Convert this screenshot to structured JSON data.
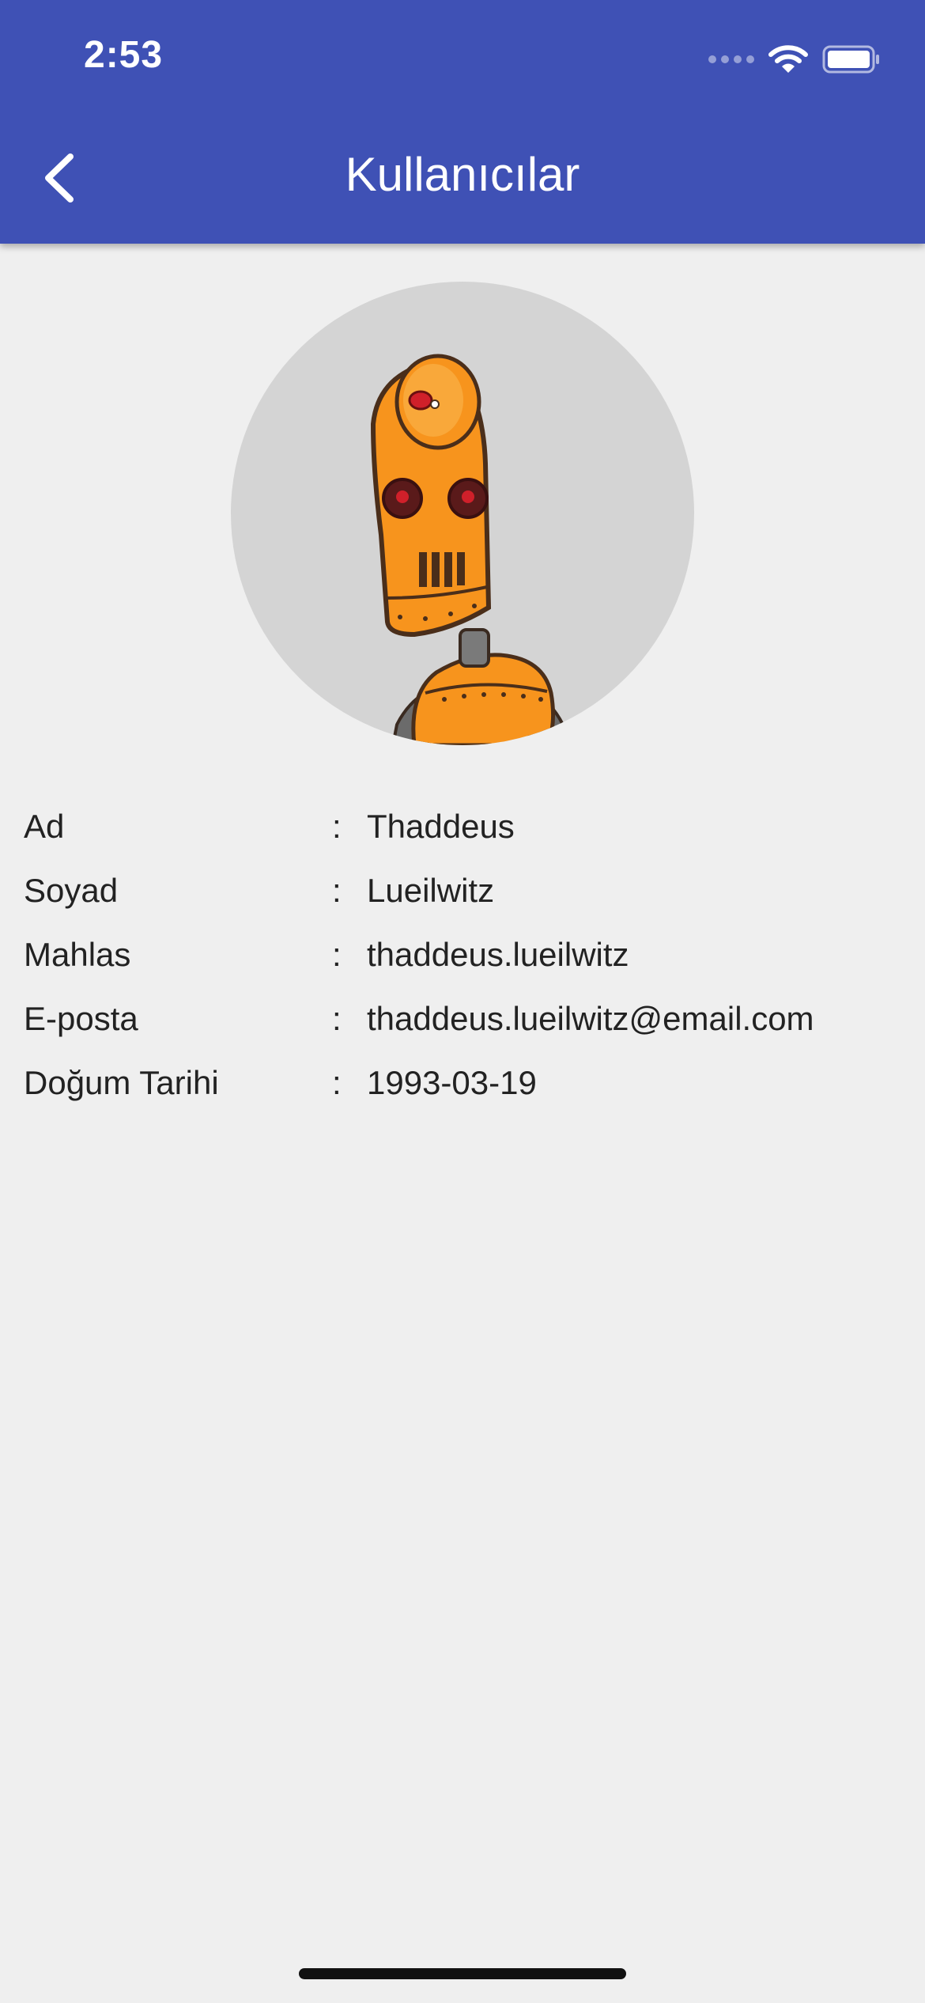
{
  "status_bar": {
    "time": "2:53"
  },
  "app_bar": {
    "title": "Kullanıcılar",
    "back_icon": "chevron-left-icon",
    "color": "#3f51b5"
  },
  "avatar": {
    "icon": "robot-avatar",
    "background": "#d4d4d4"
  },
  "fields": [
    {
      "label": "Ad",
      "separator": ":",
      "value": "Thaddeus"
    },
    {
      "label": "Soyad",
      "separator": ":",
      "value": "Lueilwitz"
    },
    {
      "label": "Mahlas",
      "separator": ":",
      "value": "thaddeus.lueilwitz"
    },
    {
      "label": "E-posta",
      "separator": ":",
      "value": "thaddeus.lueilwitz@email.com"
    },
    {
      "label": "Doğum Tarihi",
      "separator": ":",
      "value": "1993-03-19"
    }
  ]
}
